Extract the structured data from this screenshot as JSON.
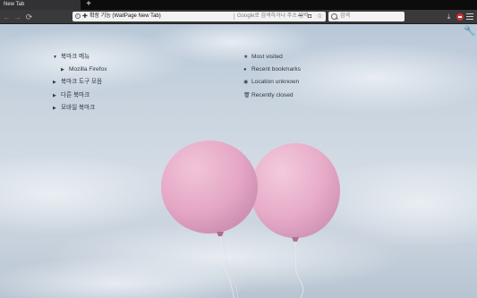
{
  "tab": {
    "title": "New Tab"
  },
  "tabstrip": {
    "new_tab_glyph": "+"
  },
  "toolbar": {
    "back_glyph": "←",
    "forward_glyph": "→",
    "reload_glyph": "⟳",
    "url_info_glyph": "i",
    "extension_icon_glyph": "✚",
    "extension_label": "확장 기능 (WallPage New Tab)",
    "url_placeholder": "Google로 검색하거나 주소 입력",
    "page_actions_glyph": "•••",
    "pocket_glyph": "◘",
    "star_glyph": "☆",
    "download_glyph": "⤓"
  },
  "search": {
    "placeholder": "검색"
  },
  "page": {
    "settings_glyph": "🔧",
    "bookmarks": [
      {
        "label": "북마크 메뉴",
        "arrow": "▼",
        "child": false
      },
      {
        "label": "Mozilla Firefox",
        "arrow": "▶",
        "child": true
      },
      {
        "label": "북마크 도구 모음",
        "arrow": "▶",
        "child": false
      },
      {
        "label": "다른 북마크",
        "arrow": "▶",
        "child": false
      },
      {
        "label": "모바일 북마크",
        "arrow": "▶",
        "child": false
      }
    ],
    "shortcuts": [
      {
        "label": "Most visited",
        "icon": "★",
        "icon_name": "star-icon"
      },
      {
        "label": "Recent bookmarks",
        "icon": "●",
        "icon_name": "bookmark-dot-icon"
      },
      {
        "label": "Location unknown",
        "icon": "◉",
        "icon_name": "eye-icon"
      },
      {
        "label": "Recently closed",
        "icon": "🗑",
        "icon_name": "trash-icon"
      }
    ]
  },
  "colors": {
    "balloon": "#e4a6c4",
    "sky_top": "#b9c8d8",
    "sky_bottom": "#b7c4d2",
    "toolbar": "#3a3a3c"
  }
}
